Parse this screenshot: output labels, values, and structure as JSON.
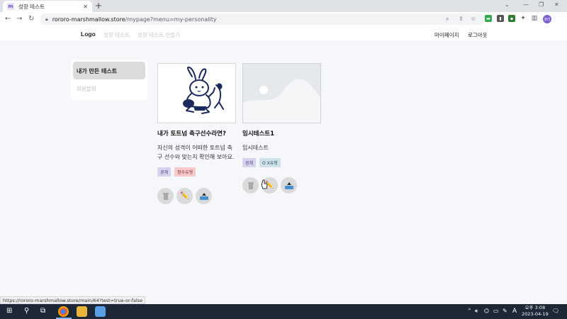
{
  "browser": {
    "tab_title": "성향 테스트",
    "tab_favicon": "m",
    "tab_close": "✕",
    "new_tab": "+",
    "url_host": "rororo-marshmallow.store",
    "url_path": "/mypage?menu=my-personality",
    "back": "←",
    "forward": "→",
    "reload": "↻",
    "profile_initials": "코더"
  },
  "header": {
    "logo": "Logo",
    "nav": [
      "성향 테스트",
      "성향 테스트 만들기"
    ],
    "mypage": "마이페이지",
    "logout": "로그아웃"
  },
  "sidebar": {
    "items": [
      {
        "label": "내가 만든 테스트",
        "active": true
      },
      {
        "label": "회원탈퇴",
        "active": false
      }
    ]
  },
  "cards": [
    {
      "title": "내가 토트넘 축구선수라면?",
      "desc": "자신의 성격이 어떠한 토트넘 축구 선수와 맞는지 확인해 보아요.",
      "badges": [
        "공개",
        "점수유형"
      ],
      "image": "rabbit-football-illustration"
    },
    {
      "title": "임시테스트1",
      "desc": "임시테스트",
      "badges": [
        "공개",
        "O X유형"
      ],
      "image": "placeholder-image"
    }
  ],
  "status_url": "https://rororo-marshmallow.store/main/64?test=true-or-false",
  "taskbar": {
    "time": "오후 3:08",
    "date": "2023-04-19",
    "ime": "A"
  },
  "colors": {
    "badge_public": "#d7d3ee",
    "badge_score": "#f5caca",
    "badge_ox": "#cfe2ec",
    "accent": "#7b5fd1"
  }
}
